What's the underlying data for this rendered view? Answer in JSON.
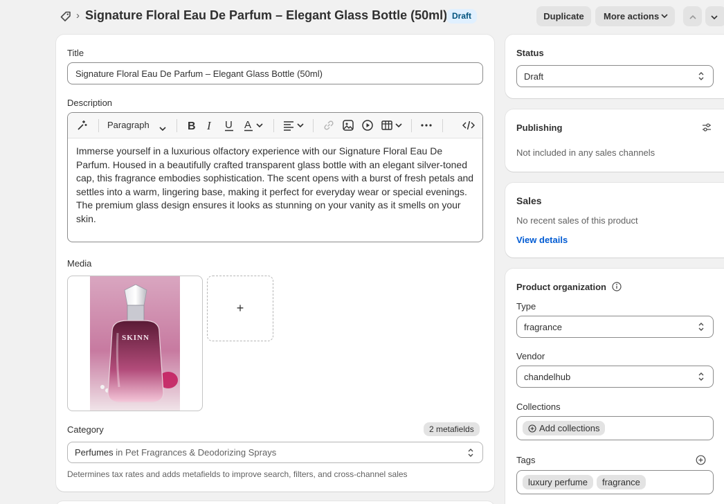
{
  "header": {
    "title": "Signature Floral Eau De Parfum – Elegant Glass Bottle (50ml)",
    "separator": "›",
    "status_badge": "Draft",
    "duplicate_label": "Duplicate",
    "more_actions_label": "More actions"
  },
  "main": {
    "title_label": "Title",
    "title_value": "Signature Floral Eau De Parfum – Elegant Glass Bottle (50ml)",
    "description_label": "Description",
    "paragraph_label": "Paragraph",
    "description_text": "Immerse yourself in a luxurious olfactory experience with our Signature Floral Eau De Parfum. Housed in a beautifully crafted transparent glass bottle with an elegant silver-toned cap, this fragrance embodies sophistication. The scent opens with a burst of fresh petals and settles into a warm, lingering base, making it perfect for everyday wear or special evenings. The premium glass design ensures it looks as stunning on your vanity as it smells on your skin.",
    "media_label": "Media",
    "media_add": "+",
    "bottle_brand": "SKINN",
    "category_label": "Category",
    "metafields_label": "2 metafields",
    "category_name": "Perfumes",
    "category_path": " in Pet Fragrances & Deodorizing Sprays",
    "category_help": "Determines tax rates and adds metafields to improve search, filters, and cross-channel sales"
  },
  "sidebar": {
    "status_label": "Status",
    "status_value": "Draft",
    "publishing_label": "Publishing",
    "publishing_text": "Not included in any sales channels",
    "sales_label": "Sales",
    "sales_text": "No recent sales of this product",
    "view_details": "View details",
    "org_label": "Product organization",
    "type_label": "Type",
    "type_value": "fragrance",
    "vendor_label": "Vendor",
    "vendor_value": "chandelhub",
    "collections_label": "Collections",
    "add_collections": "Add collections",
    "tags_label": "Tags",
    "tags": [
      "luxury perfume",
      "fragrance"
    ]
  },
  "colors": {
    "accent_link": "#005bd3",
    "badge_bg": "#e0f0ff",
    "page_bg": "#f1f1f1"
  }
}
